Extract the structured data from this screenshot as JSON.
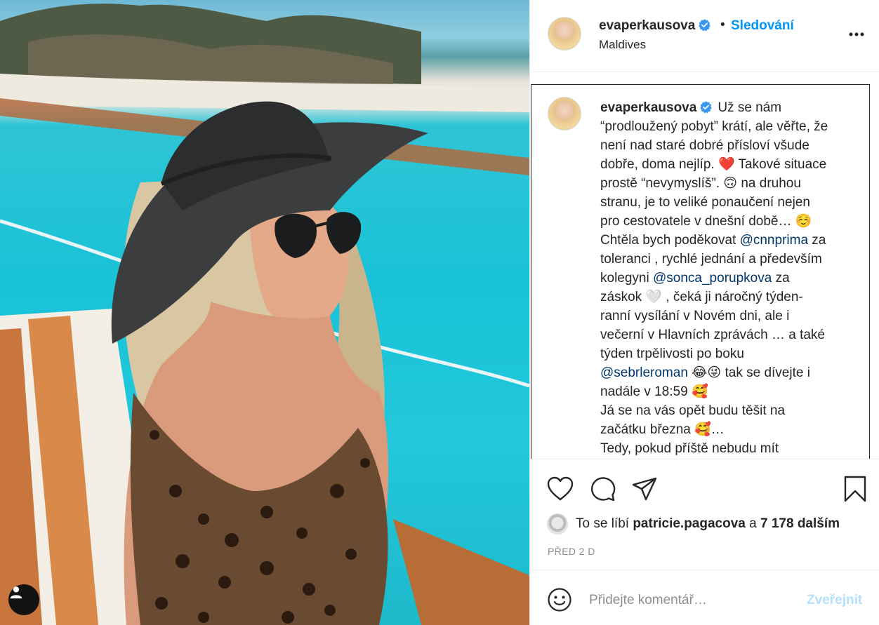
{
  "post": {
    "username": "evaperkausova",
    "follow_label": "Sledování",
    "separator": "•",
    "location": "Maldives",
    "caption_lines": [
      "Už se nám",
      "“prodloužený pobyt” krátí, ale věřte, že",
      "není nad staré dobré přísloví všude",
      "dobře, doma nejlíp. ❤️ Takové situace",
      "prostě “nevymyslíš”. 🙃 na druhou",
      "stranu, je to veliké ponaučení nejen",
      "pro cestovatele v dnešní době… ☺️",
      "Chtěla bych poděkovat @cnnprima za",
      "toleranci , rychlé jednání a především",
      "kolegyni @sonca_porupkova za",
      "záskok 🤍 , čeká ji náročný týden-",
      "ranní vysílání v Novém dni, ale i",
      "večerní v Hlavních zprávách … a také",
      "týden trpělivosti po boku",
      "@sebrleroman 😂😜 tak se dívejte i",
      "nadále v 18:59 🥰",
      "Já se na vás opět budu těšit na",
      "začátku března 🥰…",
      "Tedy, pokud příště nebudu mít"
    ],
    "mentions": [
      "@cnnprima",
      "@sonca_porupkova",
      "@sebrleroman"
    ]
  },
  "likes": {
    "prefix": "To se líbí",
    "liker": "patricie.pagacova",
    "joiner": "a",
    "others": "7 178 dalším"
  },
  "timestamp": "PŘED 2 D",
  "comment": {
    "placeholder": "Přidejte komentář…",
    "publish_label": "Zveřejnit"
  },
  "icons": {
    "verified": "verified-badge-icon",
    "more": "more-options-icon",
    "like": "heart-icon",
    "comment": "comment-icon",
    "share": "paper-plane-icon",
    "save": "bookmark-icon",
    "emoji": "smiley-icon",
    "user_tag": "user-tag-icon"
  },
  "colors": {
    "accent": "#0095f6",
    "publish_disabled": "#b2dffc",
    "mention": "#00376b",
    "muted": "#8e8e8e"
  }
}
